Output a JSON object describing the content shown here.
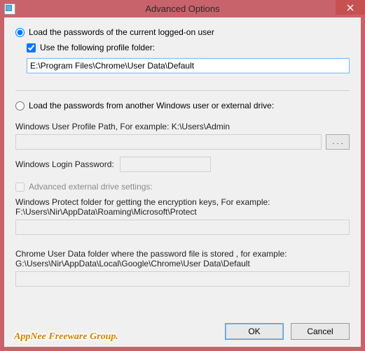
{
  "window": {
    "title": "Advanced Options"
  },
  "radio1": {
    "label": "Load the passwords of the current logged-on user",
    "checked": true
  },
  "check1": {
    "label": "Use the following profile folder:",
    "checked": true
  },
  "profile_path": "E:\\Program Files\\Chrome\\User Data\\Default",
  "radio2": {
    "label": "Load the passwords from another Windows user or external drive:",
    "checked": false
  },
  "user_profile": {
    "label": "Windows User Profile Path, For example: K:\\Users\\Admin",
    "value": ""
  },
  "browse_label": ". . .",
  "login_pw": {
    "label": "Windows Login Password:",
    "value": ""
  },
  "ext_check": {
    "label": "Advanced external drive settings:",
    "checked": false
  },
  "protect_folder": {
    "label": "Windows Protect folder for getting the encryption keys, For example: F:\\Users\\Nir\\AppData\\Roaming\\Microsoft\\Protect",
    "value": ""
  },
  "chrome_folder": {
    "label": "Chrome User Data folder where the password file is stored , for example: G:\\Users\\Nir\\AppData\\Local\\Google\\Chrome\\User Data\\Default",
    "value": ""
  },
  "buttons": {
    "ok": "OK",
    "cancel": "Cancel"
  },
  "watermark": "AppNee Freeware Group."
}
